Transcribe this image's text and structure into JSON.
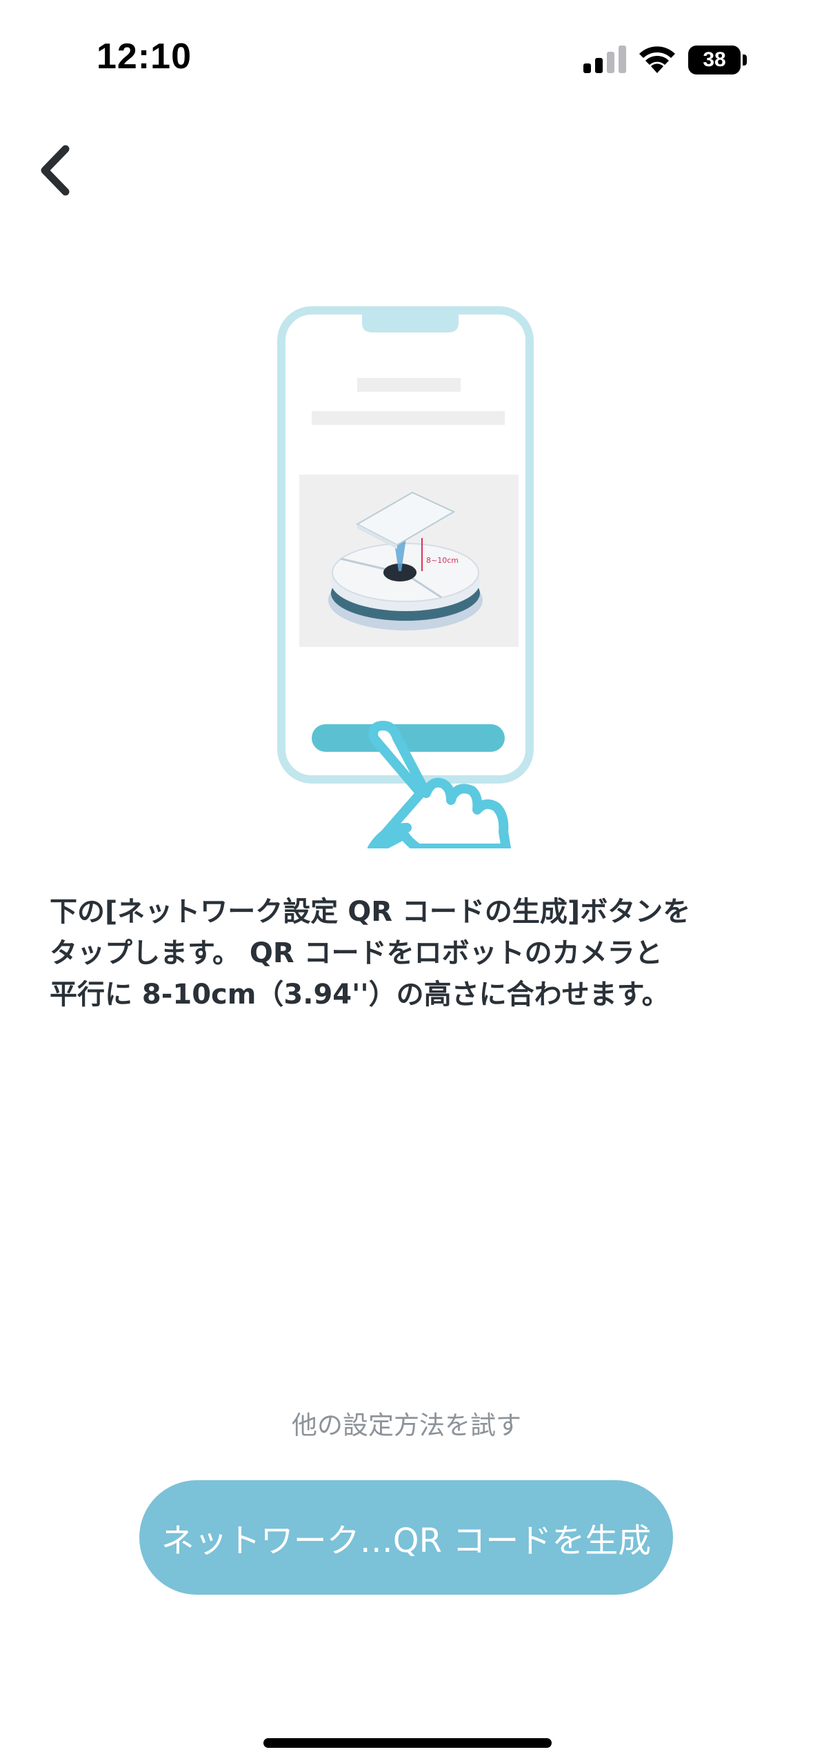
{
  "status_bar": {
    "time": "12:10",
    "battery_level": "38",
    "icons": [
      "signal-icon",
      "wifi-icon",
      "battery-icon"
    ]
  },
  "nav": {
    "back_icon": "chevron-left-icon"
  },
  "illustration": {
    "measurement_label": "8~10cm",
    "accent_color": "#5bc1d2",
    "frame_color": "#c2e6ed"
  },
  "instruction": {
    "text": "下の[ネットワーク設定 QR コードの生成]ボタンを\nタップします。 QR コードをロボットのカメラと\n平行に 8-10cm（3.94''）の高さに合わせます。"
  },
  "actions": {
    "alt_link_label": "他の設定方法を試す",
    "primary_button_label": "ネットワーク…QR コードを生成",
    "primary_color": "#7bc1d8"
  }
}
